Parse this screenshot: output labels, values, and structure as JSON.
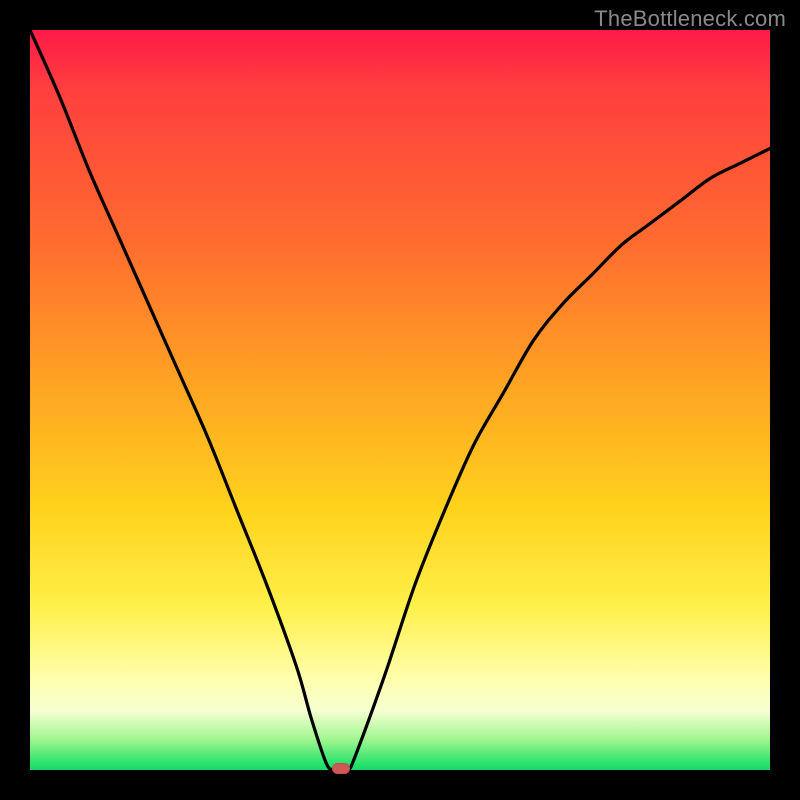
{
  "watermark": "TheBottleneck.com",
  "colors": {
    "frame_bg": "#000000",
    "curve_stroke": "#000000",
    "marker_fill": "#cc5a52",
    "gradient_stops": [
      "#ff1a48",
      "#ff3f3f",
      "#ff6a2f",
      "#ffa423",
      "#ffd31c",
      "#fff04a",
      "#ffffb0",
      "#f6ffd0",
      "#9cf58e",
      "#2de36e",
      "#16d96a"
    ]
  },
  "chart_data": {
    "type": "line",
    "title": "",
    "xlabel": "",
    "ylabel": "",
    "xlim": [
      0,
      100
    ],
    "ylim": [
      0,
      100
    ],
    "x": [
      0,
      4,
      8,
      12,
      16,
      20,
      24,
      28,
      32,
      36,
      38,
      40,
      41,
      42,
      43,
      44,
      48,
      52,
      56,
      60,
      64,
      68,
      72,
      76,
      80,
      84,
      88,
      92,
      96,
      100
    ],
    "values": [
      100,
      91,
      81,
      72,
      63,
      54,
      45,
      35,
      25,
      14,
      7,
      1,
      0,
      0,
      0,
      2,
      13,
      25,
      35,
      44,
      51,
      58,
      63,
      67,
      71,
      74,
      77,
      80,
      82,
      84
    ],
    "marker": {
      "x": 42,
      "y": 0
    },
    "note": "V-shaped bottleneck curve; minimum at x≈42 with a small flat trough, slight asymmetry (left arm steeper, right arm rises to ~84 at x=100)."
  }
}
